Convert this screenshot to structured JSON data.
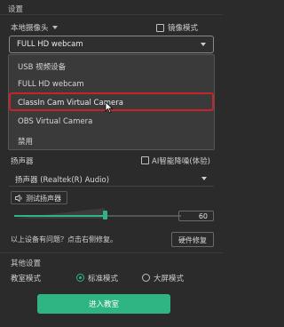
{
  "header": {
    "title": "设置"
  },
  "camera": {
    "label": "本地摄像头",
    "mirror_label": "镜像模式",
    "selected": "FULL HD webcam",
    "options": [
      "USB 视频设备",
      "FULL HD webcam",
      "ClassIn Cam Virtual Camera",
      "OBS Virtual Camera",
      "禁用"
    ]
  },
  "speaker": {
    "label": "扬声器",
    "ai_label": "AI智能降噪(体验)",
    "selected": "扬声器 (Realtek(R) Audio)",
    "test_label": "测试扬声器",
    "volume": "60",
    "volume_fraction": 0.6
  },
  "troubleshoot": {
    "text": "以上设备有问题？点击右侧修复。",
    "repair_label": "硬件修复"
  },
  "other": {
    "title": "其他设置",
    "mode_label": "教室模式",
    "option_standard": "标准模式",
    "option_large": "大屏模式"
  },
  "enter_label": "进入教室",
  "colors": {
    "accent": "#2fb583",
    "highlight": "#c4242c",
    "background": "#2b2b2b"
  }
}
